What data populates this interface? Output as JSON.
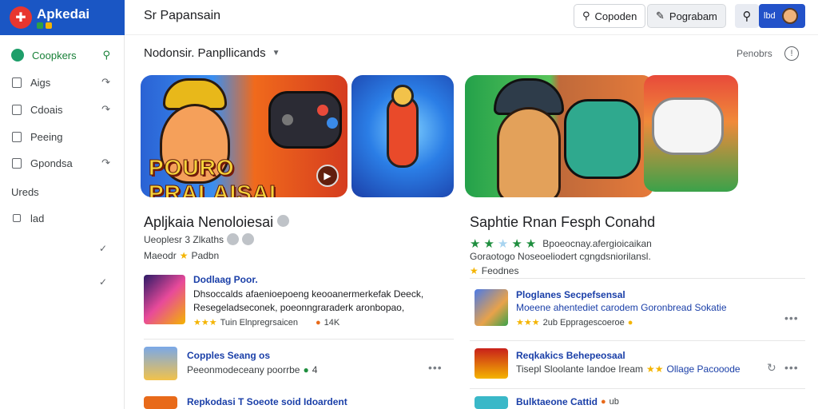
{
  "brand": {
    "name": "Apkedai"
  },
  "sidebar": {
    "items": [
      {
        "label": "Coopkers"
      },
      {
        "label": "Aigs"
      },
      {
        "label": "Cdoais"
      },
      {
        "label": "Peeing"
      },
      {
        "label": "Gpondsa"
      },
      {
        "label": "Ureds"
      },
      {
        "label": "lad"
      }
    ]
  },
  "topbar": {
    "title": "Sr Papansain",
    "btn_open": "Copoden",
    "btn_edit": "Pograbam",
    "user_label": "lbd"
  },
  "filter": {
    "label": "Nodonsir. Panpllicands",
    "right_label": "Penobrs"
  },
  "featured_left": {
    "title": "Apljkaia Nenoloiesai",
    "banner_text": "POURO PRALAISAI",
    "sub1": "Ueoplesr 3 Zlkaths",
    "sub2_prefix": "Maeodr",
    "sub2_suffix": "Padbn"
  },
  "featured_right": {
    "title": "Saphtie Rnan Fesph Conahd",
    "rating_text": "Bpoeocnay.afergioicaikan",
    "desc": "Goraotogo Noseoeliodert cgngdsniorilansl.",
    "sub_suffix": "Feodnes"
  },
  "list_left": [
    {
      "title": "Dodlaag Poor.",
      "desc1": "Dhsoccalds afaenioepoeng keooanermerkefak Deeck,",
      "desc2": "Resegeladseconek, poeonngraraderk aronbopao,",
      "rating_text": "Tuin Elnpregrsaicen",
      "count": "14K"
    },
    {
      "title": "Copples Seang os",
      "desc": "Peeonmodeceany poorrbe",
      "count": "4"
    },
    {
      "title": "Repkodasi T Soeote soid Idoardent"
    }
  ],
  "list_right": [
    {
      "title": "Ploglanes Secpefsensal",
      "desc": "Moeene ahentediet carodem Goronbread Sokatie",
      "rating_text": "2ub Eppragescoeroe"
    },
    {
      "title": "Reqkakics Behepeosaal",
      "desc": "Tisepl Sloolante Iandoe Iream",
      "desc_suffix": "Ollage Pacooode"
    },
    {
      "title": "Bulktaeone Cattid",
      "desc": "ub"
    }
  ],
  "colors": {
    "brand": "#1a56c4",
    "accent_green": "#188038",
    "link_blue": "#1a3fa8"
  }
}
